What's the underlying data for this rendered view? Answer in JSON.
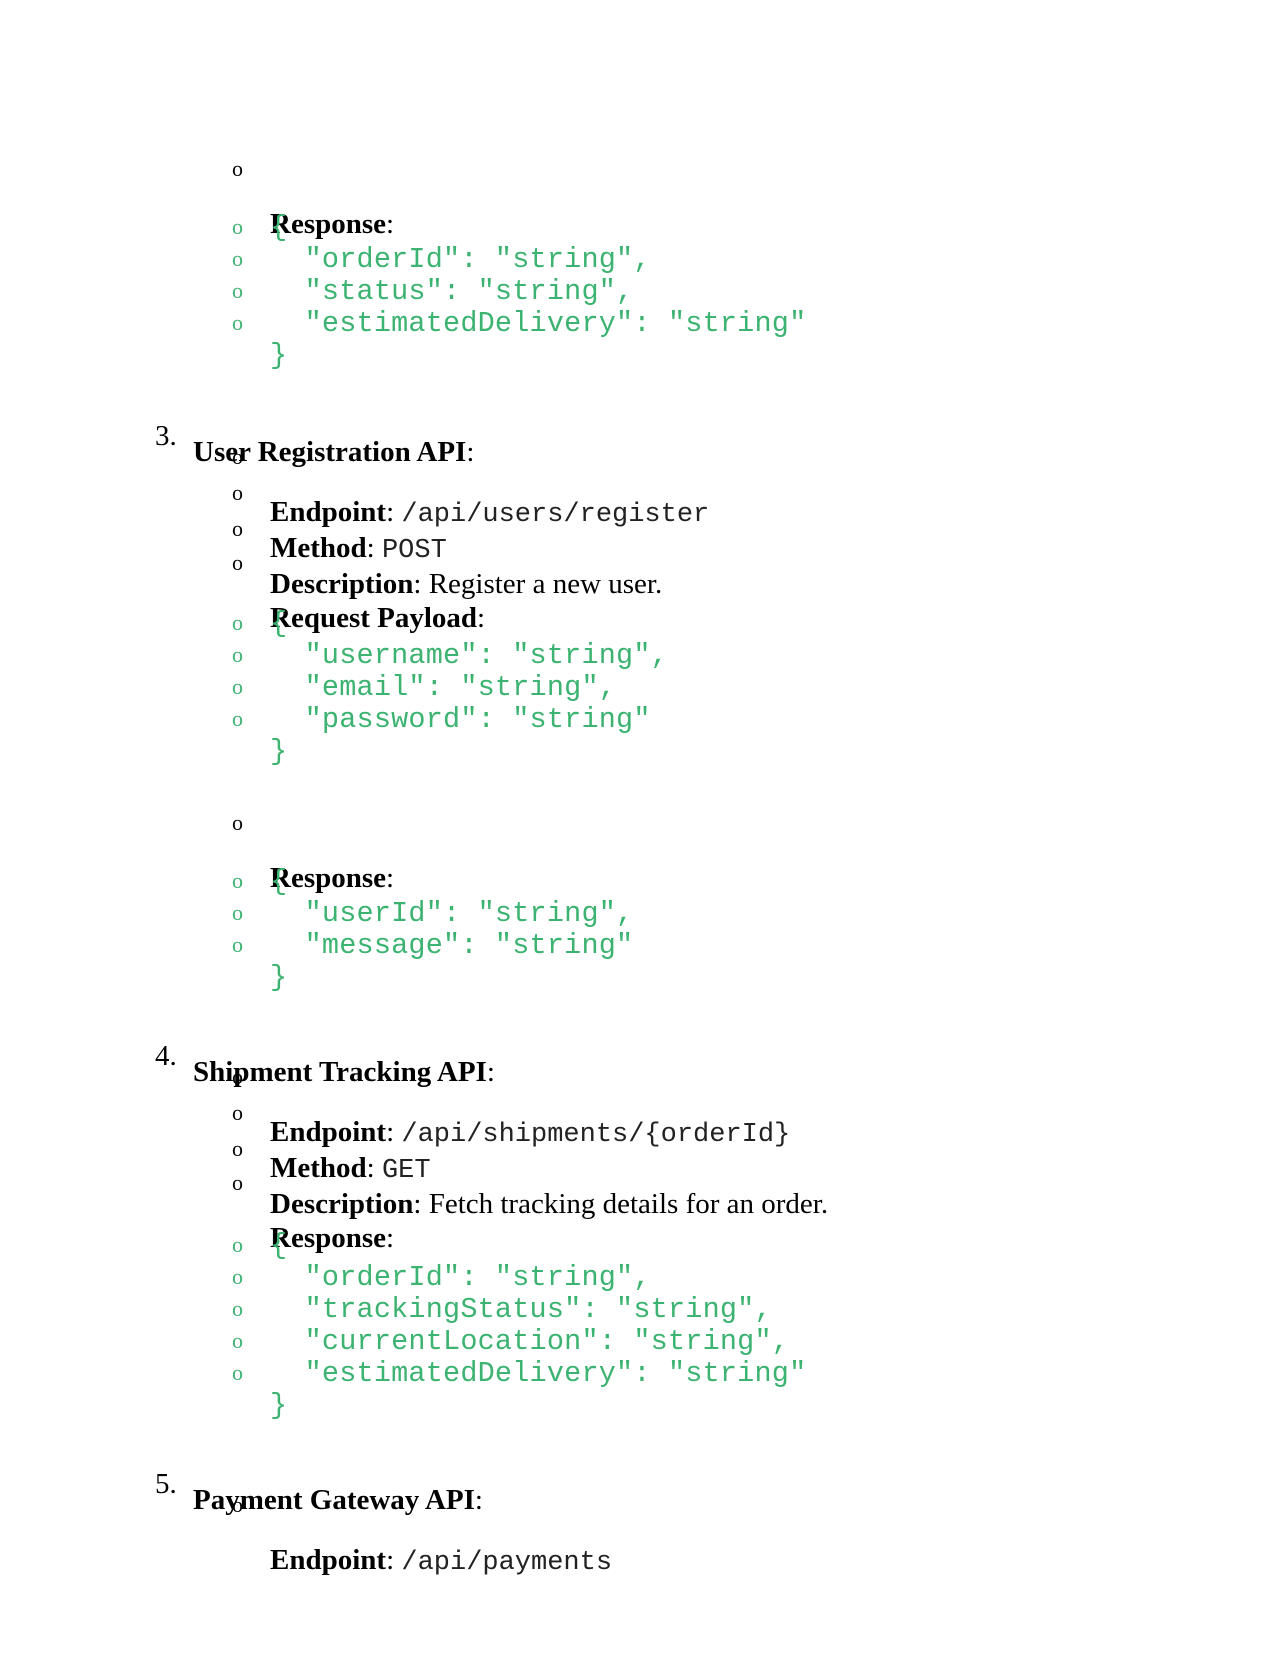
{
  "section2_tail": {
    "response_label": "Response",
    "response_code": [
      "{",
      "  \"orderId\": \"string\",",
      "  \"status\": \"string\",",
      "  \"estimatedDelivery\": \"string\"",
      "}"
    ]
  },
  "section3": {
    "number": "3.",
    "title": "User Registration API",
    "endpoint_label": "Endpoint",
    "endpoint_value": "/api/users/register",
    "method_label": "Method",
    "method_value": "POST",
    "description_label": "Description",
    "description_value": "Register a new user.",
    "request_label": "Request Payload",
    "request_code": [
      "{",
      "  \"username\": \"string\",",
      "  \"email\": \"string\",",
      "  \"password\": \"string\"",
      "}"
    ],
    "response_label": "Response",
    "response_code": [
      "{",
      "  \"userId\": \"string\",",
      "  \"message\": \"string\"",
      "}"
    ]
  },
  "section4": {
    "number": "4.",
    "title": "Shipment Tracking API",
    "endpoint_label": "Endpoint",
    "endpoint_value": "/api/shipments/{orderId}",
    "method_label": "Method",
    "method_value": "GET",
    "description_label": "Description",
    "description_value": "Fetch tracking details for an order.",
    "response_label": "Response",
    "response_code": [
      "{",
      "  \"orderId\": \"string\",",
      "  \"trackingStatus\": \"string\",",
      "  \"currentLocation\": \"string\",",
      "  \"estimatedDelivery\": \"string\"",
      "}"
    ]
  },
  "section5": {
    "number": "5.",
    "title": "Payment Gateway API",
    "endpoint_label": "Endpoint",
    "endpoint_value": "/api/payments"
  },
  "bullet_glyph": "o",
  "colors": {
    "code": "#3cb371",
    "text": "#000000"
  }
}
